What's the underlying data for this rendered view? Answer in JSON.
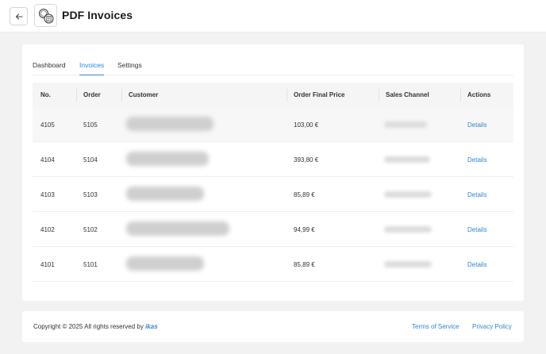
{
  "header": {
    "title": "PDF Invoices",
    "back_icon": "arrow-left-icon",
    "logo_icon": "invoice-coins-icon"
  },
  "tabs": [
    {
      "label": "Dashboard",
      "active": false
    },
    {
      "label": "Invoices",
      "active": true
    },
    {
      "label": "Settings",
      "active": false
    }
  ],
  "table": {
    "columns": [
      "No.",
      "Order",
      "Customer",
      "Order Final Price",
      "Sales Channel",
      "Actions"
    ],
    "rows": [
      {
        "no": "4105",
        "order": "5105",
        "customer": "",
        "price": "103,00 €",
        "channel": "",
        "action": "Details"
      },
      {
        "no": "4104",
        "order": "5104",
        "customer": "",
        "price": "393,80 €",
        "channel": "",
        "action": "Details"
      },
      {
        "no": "4103",
        "order": "5103",
        "customer": "",
        "price": "85,89 €",
        "channel": "",
        "action": "Details"
      },
      {
        "no": "4102",
        "order": "5102",
        "customer": "",
        "price": "94,99 €",
        "channel": "",
        "action": "Details"
      },
      {
        "no": "4101",
        "order": "5101",
        "customer": "",
        "price": "85,89 €",
        "channel": "",
        "action": "Details"
      }
    ]
  },
  "footer": {
    "copyright_prefix": "Copyright © 2025 All rights reserved by ",
    "brand": "ikas",
    "terms": "Terms of Service",
    "privacy": "Privacy Policy"
  },
  "colors": {
    "accent": "#2e86d9",
    "background": "#f2f2f2",
    "surface": "#ffffff"
  }
}
